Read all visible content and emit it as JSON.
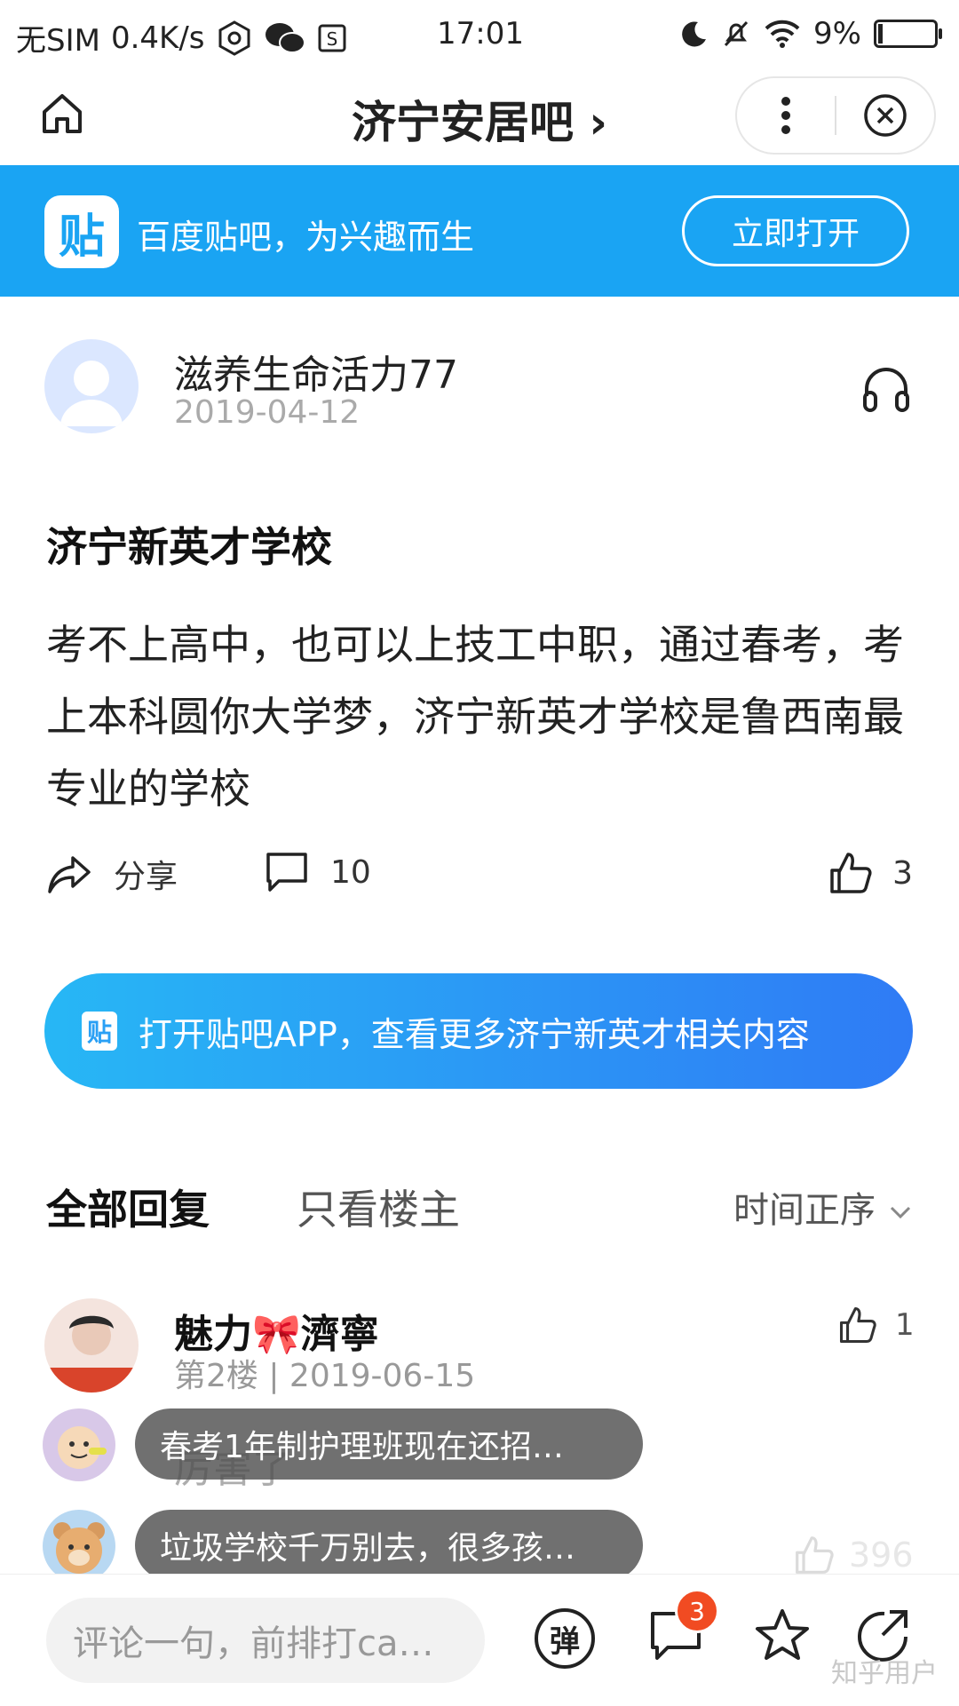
{
  "status_bar": {
    "carrier": "无SIM",
    "speed": "0.4K/s",
    "time": "17:01",
    "battery": "9%",
    "battery_level": 0.09
  },
  "nav": {
    "title": "济宁安居吧 ›"
  },
  "banner": {
    "logo_text": "贴",
    "slogan": "百度贴吧，为兴趣而生",
    "open_button": "立即打开",
    "color": "#1aa4f3"
  },
  "post": {
    "author": "滋养生命活力77",
    "date": "2019-04-12",
    "title": "济宁新英才学校",
    "body": "考不上高中，也可以上技工中职，通过春考，考上本科圆你大学梦，济宁新英才学校是鲁西南最专业的学校",
    "share_label": "分享",
    "comment_count": "10",
    "like_count": "3"
  },
  "cta": {
    "logo_text": "贴",
    "text": "打开贴吧APP，查看更多济宁新英才相关内容"
  },
  "reply_tabs": {
    "all": "全部回复",
    "owner_only": "只看楼主",
    "sort": "时间正序"
  },
  "replies": [
    {
      "name": "魅力🎀濟寧",
      "floor_date": "第2楼 | 2019-06-15",
      "likes": "1"
    },
    {
      "text": "厉害了"
    },
    {
      "likes": "396"
    }
  ],
  "danmaku": [
    "春考1年制护理班现在还招…",
    "垃圾学校千万别去，很多孩…"
  ],
  "bottom_bar": {
    "comment_placeholder": "评论一句，前排打ca…",
    "danmu_label": "弹",
    "message_badge": "3",
    "watermark": "知乎用户"
  }
}
